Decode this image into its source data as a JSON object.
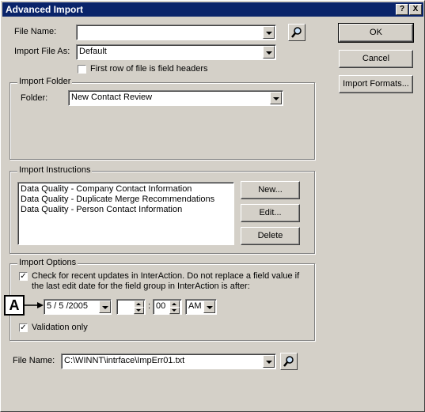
{
  "window": {
    "title": "Advanced Import",
    "help_btn": "?",
    "close_btn": "X"
  },
  "buttons": {
    "ok": "OK",
    "cancel": "Cancel",
    "import_formats": "Import Formats..."
  },
  "file_name": {
    "label": "File Name:",
    "value": ""
  },
  "import_file_as": {
    "label": "Import File As:",
    "value": "Default"
  },
  "first_row_checkbox": {
    "label": "First row of file is field headers",
    "checked": false
  },
  "import_folder": {
    "group_label": "Import Folder",
    "folder_label": "Folder:",
    "folder_value": "New Contact Review"
  },
  "import_instructions": {
    "group_label": "Import Instructions",
    "items": [
      "Data Quality - Company Contact Information",
      "Data Quality - Duplicate Merge Recommendations",
      "Data Quality - Person Contact Information"
    ],
    "new_btn": "New...",
    "edit_btn": "Edit...",
    "delete_btn": "Delete"
  },
  "import_options": {
    "group_label": "Import Options",
    "check_updates_label_line1": "Check for recent updates in InterAction. Do not replace a field value if",
    "check_updates_label_line2": "the last edit date for the field group in InterAction is after:",
    "check_updates_mark": "✓",
    "date_value": "5 / 5 /2005",
    "hour_value": "",
    "colon": ":",
    "minute_value": "00",
    "ampm_value": "AM",
    "validation_label": "Validation only",
    "validation_mark": "✓",
    "callout_letter": "A"
  },
  "error_file": {
    "label": "File Name:",
    "value": "C:\\WINNT\\intrface\\ImpErr01.txt"
  }
}
